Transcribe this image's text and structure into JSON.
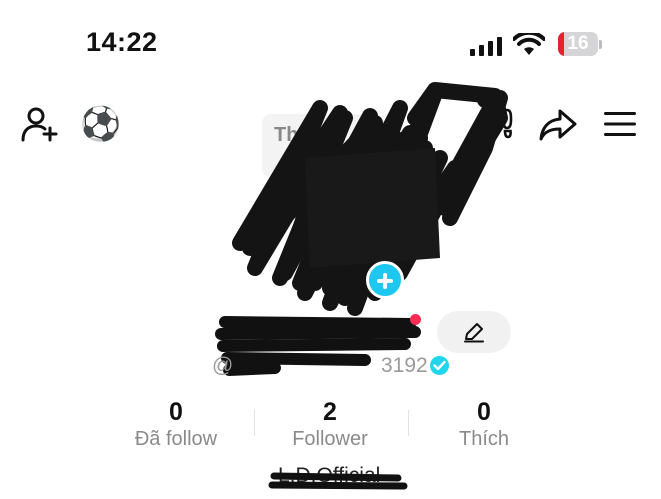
{
  "status_bar": {
    "time": "14:22",
    "battery_percent": "16",
    "battery_level": 0.16,
    "battery_color": "#e0242f"
  },
  "nav": {
    "add_user_icon": "add-user-icon",
    "soccer_emoji": "⚽",
    "footprints_icon": "footprints-icon",
    "share_icon": "share-icon",
    "menu_icon": "hamburger-menu-icon"
  },
  "profile": {
    "name_chip_visible": "Th",
    "handle_prefix": "@",
    "handle_suffix": "3192",
    "verified_color": "#20d5ec",
    "avatar_add_color": "#1ec7f0",
    "notification_dot_color": "#fe2c55"
  },
  "stats": [
    {
      "value": "0",
      "label": "Đã follow"
    },
    {
      "value": "2",
      "label": "Follower"
    },
    {
      "value": "0",
      "label": "Thích"
    }
  ],
  "bio": {
    "text": "L.D.Official"
  }
}
